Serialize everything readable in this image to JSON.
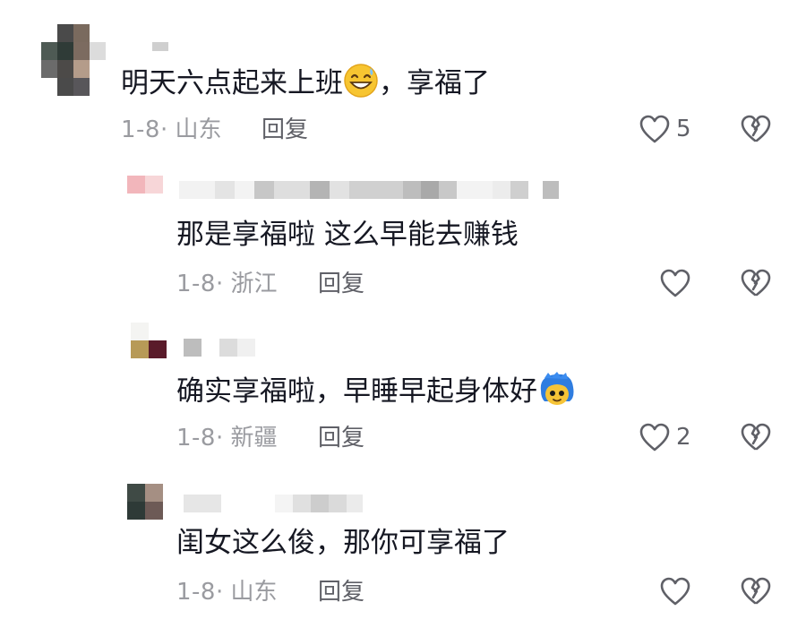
{
  "comments": [
    {
      "text": "明天六点起来上班",
      "text_after": "，享福了",
      "emoji": "grinning-sweat-emoji",
      "date": "1-8",
      "location": "· 山东",
      "reply_label": "回复",
      "likes": "5"
    },
    {
      "text": "那是享福啦 这么早能去赚钱",
      "date": "1-8",
      "location": "· 浙江",
      "reply_label": "回复",
      "likes": ""
    },
    {
      "text": "确实享福啦，早睡早起身体好",
      "emoji": "blue-hair-face-emoji",
      "date": "1-8",
      "location": "· 新疆",
      "reply_label": "回复",
      "likes": "2"
    },
    {
      "text": "闺女这么俊，那你可享福了",
      "date": "1-8",
      "location": "· 山东",
      "reply_label": "回复",
      "likes": ""
    }
  ],
  "icons": {
    "like": "heart-outline-icon",
    "dislike": "broken-heart-icon"
  },
  "colors": {
    "text": "#161823",
    "meta": "#9a9ba0",
    "action": "#5f6067",
    "icon": "#5f6067"
  }
}
